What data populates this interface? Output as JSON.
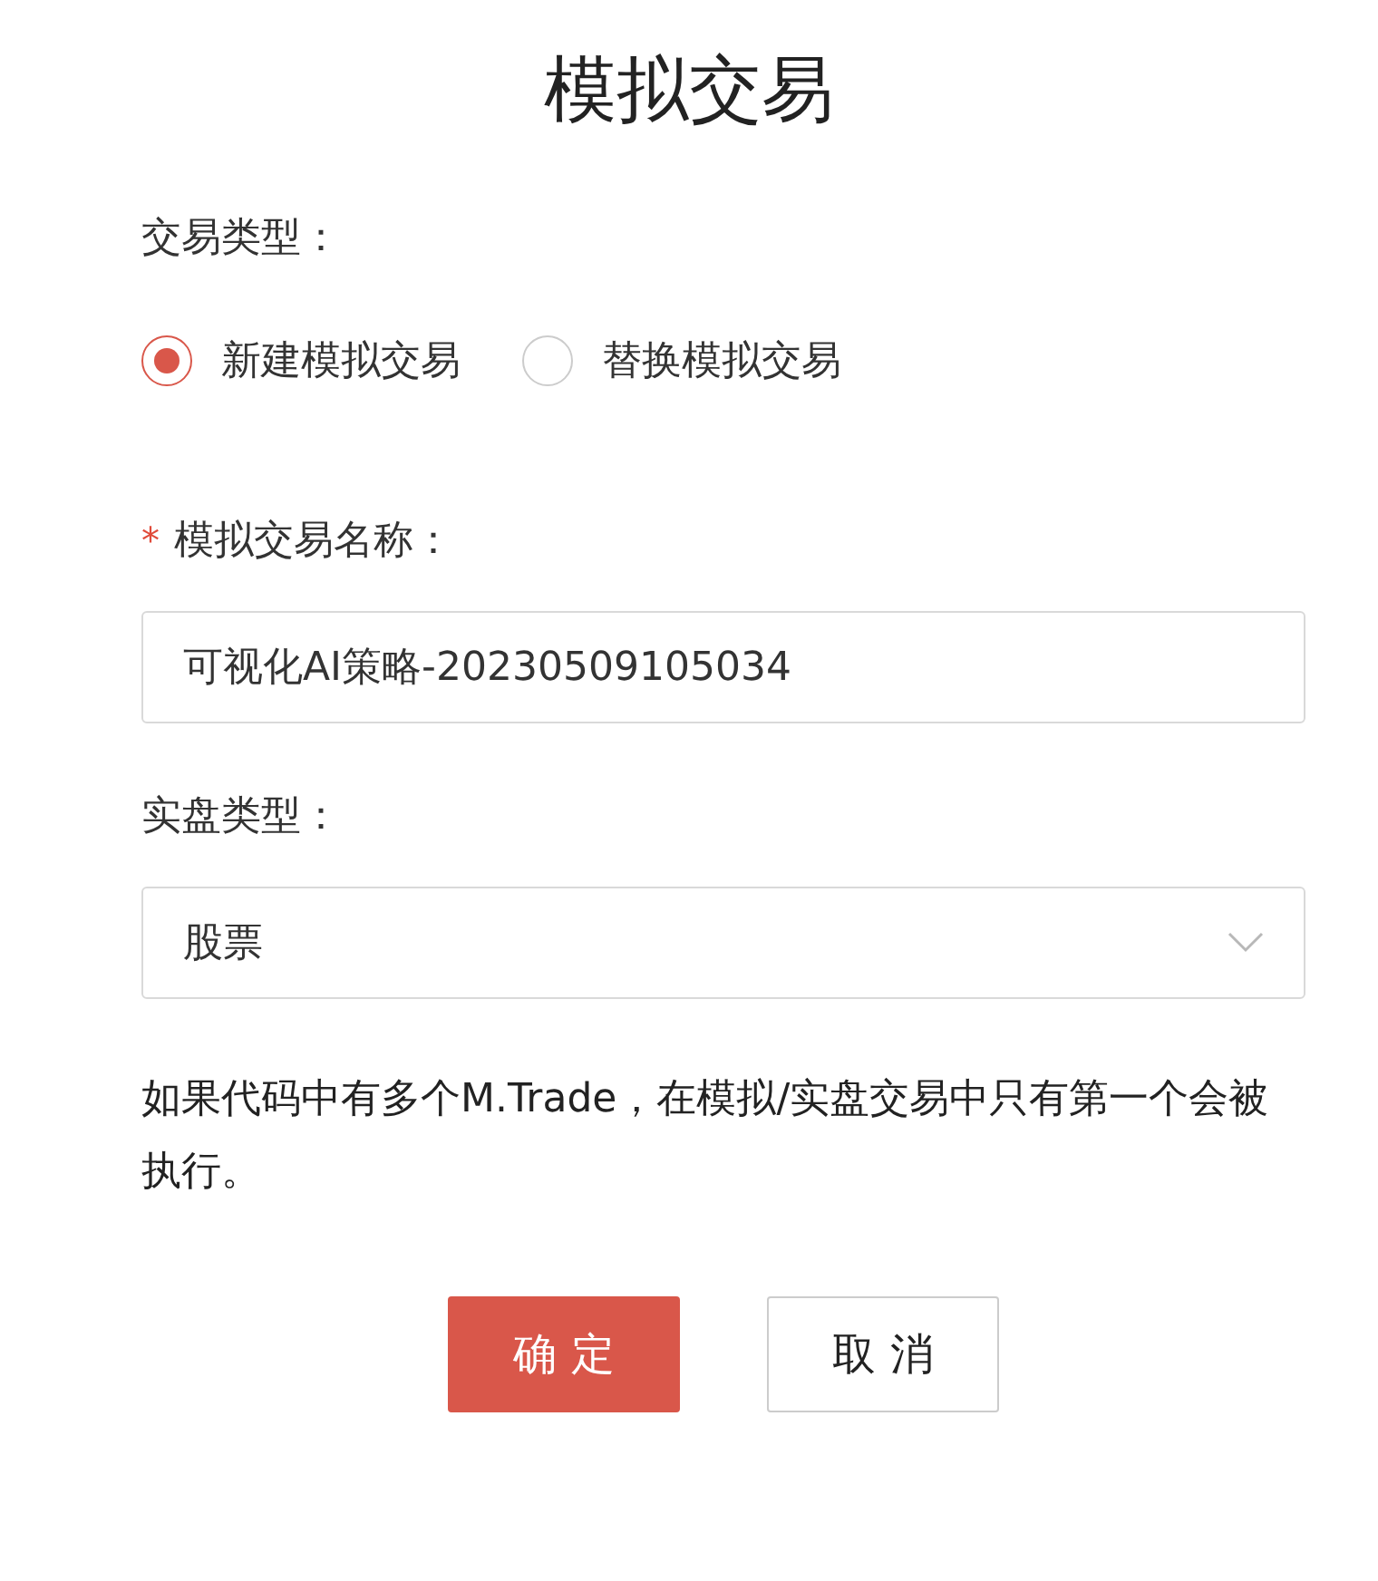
{
  "title": "模拟交易",
  "trade_type": {
    "label": "交易类型：",
    "options": [
      {
        "label": "新建模拟交易",
        "selected": true
      },
      {
        "label": "替换模拟交易",
        "selected": false
      }
    ]
  },
  "name_field": {
    "label": "模拟交易名称：",
    "required_mark": "*",
    "value": "可视化AI策略-20230509105034"
  },
  "account_type": {
    "label": "实盘类型：",
    "value": "股票"
  },
  "note": "如果代码中有多个M.Trade，在模拟/实盘交易中只有第一个会被执行。",
  "buttons": [
    {
      "label": "确 定",
      "kind": "primary"
    },
    {
      "label": "取 消",
      "kind": "default"
    }
  ]
}
